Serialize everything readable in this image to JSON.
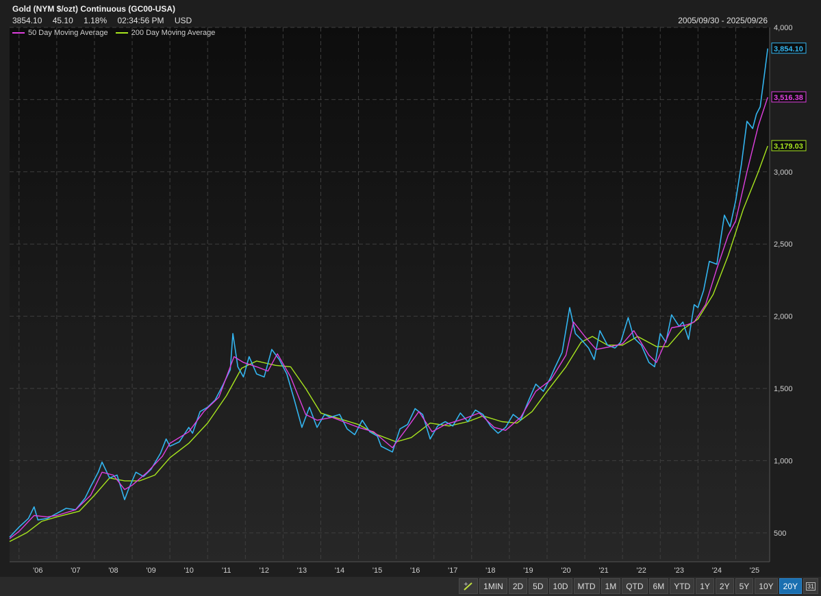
{
  "header": {
    "title": "Gold (NYM $/ozt) Continuous (GC00-USA)",
    "last": "3854.10",
    "change": "45.10",
    "change_pct": "1.18%",
    "time": "02:34:56 PM",
    "currency": "USD",
    "date_range": "2005/09/30 - 2025/09/26"
  },
  "legend": [
    {
      "name": "50 Day Moving Average",
      "color": "#e040e0"
    },
    {
      "name": "200 Day Moving Average",
      "color": "#a8e61e"
    }
  ],
  "chart_data": {
    "type": "line",
    "x_ticks": [
      "'06",
      "'07",
      "'08",
      "'09",
      "'10",
      "'11",
      "'12",
      "'13",
      "'14",
      "'15",
      "'16",
      "'17",
      "'18",
      "'19",
      "'20",
      "'21",
      "'22",
      "'23",
      "'24",
      "'25"
    ],
    "y_ticks": [
      500,
      1000,
      1500,
      2000,
      2500,
      3000,
      4000
    ],
    "y_tick_labels": [
      "500",
      "1,000",
      "1,500",
      "2,000",
      "2,500",
      "3,000",
      "4,000"
    ],
    "ylim": [
      300,
      4000
    ],
    "xlim": [
      2005.75,
      2025.9
    ],
    "grid": true,
    "legend_position": "top-left",
    "last_values": [
      {
        "label": "3,854.10",
        "value": 3854.1,
        "color": "#33b5f0"
      },
      {
        "label": "3,516.38",
        "value": 3516.38,
        "color": "#e040e0"
      },
      {
        "label": "3,179.03",
        "value": 3179.03,
        "color": "#a8e61e"
      }
    ],
    "series": [
      {
        "name": "Price",
        "color": "#33b5f0",
        "points": [
          [
            2005.75,
            470
          ],
          [
            2006.0,
            540
          ],
          [
            2006.25,
            600
          ],
          [
            2006.4,
            680
          ],
          [
            2006.5,
            590
          ],
          [
            2006.75,
            600
          ],
          [
            2007.0,
            635
          ],
          [
            2007.25,
            670
          ],
          [
            2007.5,
            660
          ],
          [
            2007.75,
            740
          ],
          [
            2007.9,
            820
          ],
          [
            2008.1,
            920
          ],
          [
            2008.2,
            990
          ],
          [
            2008.4,
            880
          ],
          [
            2008.6,
            900
          ],
          [
            2008.8,
            730
          ],
          [
            2008.9,
            800
          ],
          [
            2009.1,
            920
          ],
          [
            2009.3,
            890
          ],
          [
            2009.5,
            940
          ],
          [
            2009.75,
            1050
          ],
          [
            2009.9,
            1150
          ],
          [
            2010.0,
            1100
          ],
          [
            2010.25,
            1130
          ],
          [
            2010.5,
            1230
          ],
          [
            2010.6,
            1190
          ],
          [
            2010.8,
            1340
          ],
          [
            2011.0,
            1370
          ],
          [
            2011.2,
            1420
          ],
          [
            2011.4,
            1520
          ],
          [
            2011.6,
            1630
          ],
          [
            2011.67,
            1880
          ],
          [
            2011.8,
            1650
          ],
          [
            2011.95,
            1580
          ],
          [
            2012.1,
            1720
          ],
          [
            2012.3,
            1600
          ],
          [
            2012.5,
            1580
          ],
          [
            2012.7,
            1770
          ],
          [
            2012.9,
            1700
          ],
          [
            2013.1,
            1600
          ],
          [
            2013.3,
            1420
          ],
          [
            2013.5,
            1230
          ],
          [
            2013.7,
            1370
          ],
          [
            2013.9,
            1230
          ],
          [
            2014.1,
            1320
          ],
          [
            2014.25,
            1300
          ],
          [
            2014.5,
            1320
          ],
          [
            2014.7,
            1220
          ],
          [
            2014.9,
            1180
          ],
          [
            2015.1,
            1280
          ],
          [
            2015.3,
            1200
          ],
          [
            2015.5,
            1170
          ],
          [
            2015.6,
            1100
          ],
          [
            2015.9,
            1060
          ],
          [
            2016.1,
            1220
          ],
          [
            2016.3,
            1250
          ],
          [
            2016.5,
            1360
          ],
          [
            2016.7,
            1320
          ],
          [
            2016.9,
            1150
          ],
          [
            2017.1,
            1240
          ],
          [
            2017.3,
            1270
          ],
          [
            2017.5,
            1240
          ],
          [
            2017.7,
            1330
          ],
          [
            2017.9,
            1270
          ],
          [
            2018.1,
            1350
          ],
          [
            2018.3,
            1320
          ],
          [
            2018.5,
            1240
          ],
          [
            2018.7,
            1190
          ],
          [
            2018.9,
            1230
          ],
          [
            2019.1,
            1320
          ],
          [
            2019.3,
            1280
          ],
          [
            2019.5,
            1410
          ],
          [
            2019.7,
            1530
          ],
          [
            2019.9,
            1480
          ],
          [
            2020.1,
            1580
          ],
          [
            2020.2,
            1640
          ],
          [
            2020.4,
            1750
          ],
          [
            2020.6,
            2060
          ],
          [
            2020.75,
            1880
          ],
          [
            2020.9,
            1840
          ],
          [
            2021.1,
            1780
          ],
          [
            2021.25,
            1700
          ],
          [
            2021.4,
            1900
          ],
          [
            2021.6,
            1800
          ],
          [
            2021.8,
            1780
          ],
          [
            2021.95,
            1820
          ],
          [
            2022.15,
            1990
          ],
          [
            2022.3,
            1850
          ],
          [
            2022.5,
            1800
          ],
          [
            2022.7,
            1680
          ],
          [
            2022.85,
            1650
          ],
          [
            2023.0,
            1880
          ],
          [
            2023.15,
            1820
          ],
          [
            2023.3,
            2010
          ],
          [
            2023.5,
            1930
          ],
          [
            2023.6,
            1960
          ],
          [
            2023.75,
            1840
          ],
          [
            2023.9,
            2080
          ],
          [
            2024.0,
            2060
          ],
          [
            2024.15,
            2180
          ],
          [
            2024.3,
            2380
          ],
          [
            2024.5,
            2360
          ],
          [
            2024.7,
            2700
          ],
          [
            2024.85,
            2620
          ],
          [
            2025.0,
            2800
          ],
          [
            2025.15,
            3050
          ],
          [
            2025.3,
            3350
          ],
          [
            2025.45,
            3300
          ],
          [
            2025.55,
            3400
          ],
          [
            2025.65,
            3450
          ],
          [
            2025.75,
            3650
          ],
          [
            2025.85,
            3854.1
          ]
        ]
      },
      {
        "name": "50 Day Moving Average",
        "color": "#e040e0",
        "points": [
          [
            2005.75,
            460
          ],
          [
            2006.0,
            510
          ],
          [
            2006.4,
            620
          ],
          [
            2006.75,
            610
          ],
          [
            2007.0,
            620
          ],
          [
            2007.5,
            660
          ],
          [
            2007.9,
            760
          ],
          [
            2008.2,
            920
          ],
          [
            2008.5,
            900
          ],
          [
            2008.8,
            800
          ],
          [
            2009.0,
            830
          ],
          [
            2009.4,
            920
          ],
          [
            2009.8,
            1030
          ],
          [
            2010.0,
            1120
          ],
          [
            2010.5,
            1200
          ],
          [
            2010.9,
            1340
          ],
          [
            2011.3,
            1440
          ],
          [
            2011.7,
            1720
          ],
          [
            2011.95,
            1680
          ],
          [
            2012.3,
            1650
          ],
          [
            2012.6,
            1620
          ],
          [
            2012.85,
            1740
          ],
          [
            2013.2,
            1580
          ],
          [
            2013.6,
            1320
          ],
          [
            2013.9,
            1280
          ],
          [
            2014.3,
            1300
          ],
          [
            2014.7,
            1260
          ],
          [
            2015.0,
            1230
          ],
          [
            2015.4,
            1200
          ],
          [
            2015.9,
            1090
          ],
          [
            2016.3,
            1230
          ],
          [
            2016.6,
            1340
          ],
          [
            2016.95,
            1200
          ],
          [
            2017.3,
            1250
          ],
          [
            2017.8,
            1290
          ],
          [
            2018.2,
            1330
          ],
          [
            2018.6,
            1230
          ],
          [
            2018.9,
            1210
          ],
          [
            2019.3,
            1300
          ],
          [
            2019.7,
            1480
          ],
          [
            2020.1,
            1560
          ],
          [
            2020.5,
            1730
          ],
          [
            2020.7,
            1960
          ],
          [
            2021.0,
            1860
          ],
          [
            2021.3,
            1770
          ],
          [
            2021.7,
            1790
          ],
          [
            2022.0,
            1810
          ],
          [
            2022.3,
            1900
          ],
          [
            2022.7,
            1730
          ],
          [
            2022.9,
            1680
          ],
          [
            2023.3,
            1920
          ],
          [
            2023.7,
            1940
          ],
          [
            2023.9,
            1960
          ],
          [
            2024.2,
            2080
          ],
          [
            2024.5,
            2330
          ],
          [
            2024.8,
            2560
          ],
          [
            2025.0,
            2660
          ],
          [
            2025.3,
            3000
          ],
          [
            2025.6,
            3320
          ],
          [
            2025.85,
            3516.38
          ]
        ]
      },
      {
        "name": "200 Day Moving Average",
        "color": "#a8e61e",
        "points": [
          [
            2005.75,
            440
          ],
          [
            2006.2,
            500
          ],
          [
            2006.6,
            580
          ],
          [
            2007.0,
            610
          ],
          [
            2007.6,
            650
          ],
          [
            2008.0,
            760
          ],
          [
            2008.4,
            880
          ],
          [
            2008.8,
            860
          ],
          [
            2009.2,
            860
          ],
          [
            2009.6,
            900
          ],
          [
            2010.0,
            1020
          ],
          [
            2010.5,
            1120
          ],
          [
            2011.0,
            1260
          ],
          [
            2011.5,
            1450
          ],
          [
            2011.9,
            1640
          ],
          [
            2012.3,
            1690
          ],
          [
            2012.8,
            1660
          ],
          [
            2013.2,
            1650
          ],
          [
            2013.6,
            1500
          ],
          [
            2014.0,
            1330
          ],
          [
            2014.5,
            1290
          ],
          [
            2015.0,
            1250
          ],
          [
            2015.5,
            1180
          ],
          [
            2016.0,
            1130
          ],
          [
            2016.4,
            1160
          ],
          [
            2016.9,
            1260
          ],
          [
            2017.4,
            1240
          ],
          [
            2017.9,
            1270
          ],
          [
            2018.3,
            1310
          ],
          [
            2018.8,
            1270
          ],
          [
            2019.2,
            1260
          ],
          [
            2019.6,
            1340
          ],
          [
            2020.0,
            1480
          ],
          [
            2020.5,
            1650
          ],
          [
            2020.9,
            1820
          ],
          [
            2021.2,
            1860
          ],
          [
            2021.6,
            1800
          ],
          [
            2022.0,
            1800
          ],
          [
            2022.4,
            1860
          ],
          [
            2022.9,
            1790
          ],
          [
            2023.2,
            1790
          ],
          [
            2023.6,
            1910
          ],
          [
            2024.0,
            1980
          ],
          [
            2024.4,
            2150
          ],
          [
            2024.8,
            2420
          ],
          [
            2025.2,
            2740
          ],
          [
            2025.6,
            3000
          ],
          [
            2025.85,
            3179.03
          ]
        ]
      }
    ]
  },
  "toolbar": {
    "buttons": [
      "1MIN",
      "2D",
      "5D",
      "10D",
      "MTD",
      "1M",
      "QTD",
      "6M",
      "YTD",
      "1Y",
      "2Y",
      "5Y",
      "10Y",
      "20Y"
    ],
    "active": "20Y",
    "calendar_label": "31"
  }
}
